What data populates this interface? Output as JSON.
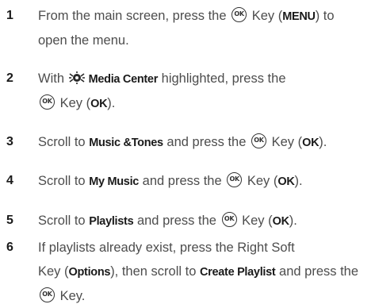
{
  "ok_key_glyph": "OK",
  "steps": [
    {
      "number": "1",
      "parts": {
        "a": "From the main screen, press the",
        "b": "Key (",
        "c": "MENU",
        "d": ") to",
        "e": "open the menu."
      }
    },
    {
      "number": "2",
      "parts": {
        "a": "With",
        "b": "Media Center",
        "c": "highlighted, press the",
        "d": "Key (",
        "e": "OK",
        "f": ")."
      }
    },
    {
      "number": "3",
      "parts": {
        "a": "Scroll to",
        "b": "Music &Tones",
        "c": "and press the",
        "d": "Key (",
        "e": "OK",
        "f": ")."
      }
    },
    {
      "number": "4",
      "parts": {
        "a": "Scroll to",
        "b": "My Music",
        "c": "and press the",
        "d": "Key (",
        "e": "OK",
        "f": ")."
      }
    },
    {
      "number": "5",
      "parts": {
        "a": "Scroll to",
        "b": "Playlists",
        "c": "and press the",
        "d": "Key (",
        "e": "OK",
        "f": ")."
      }
    },
    {
      "number": "6",
      "parts": {
        "a": "If playlists already exist, press the Right Soft",
        "b": "Key (",
        "c": "Options",
        "d": "), then scroll to",
        "e": "Create Playlist",
        "f": "and press the",
        "g": "Key."
      }
    }
  ],
  "icons": {
    "ok_key": "ok-key-icon",
    "media_center": "media-center-icon"
  }
}
